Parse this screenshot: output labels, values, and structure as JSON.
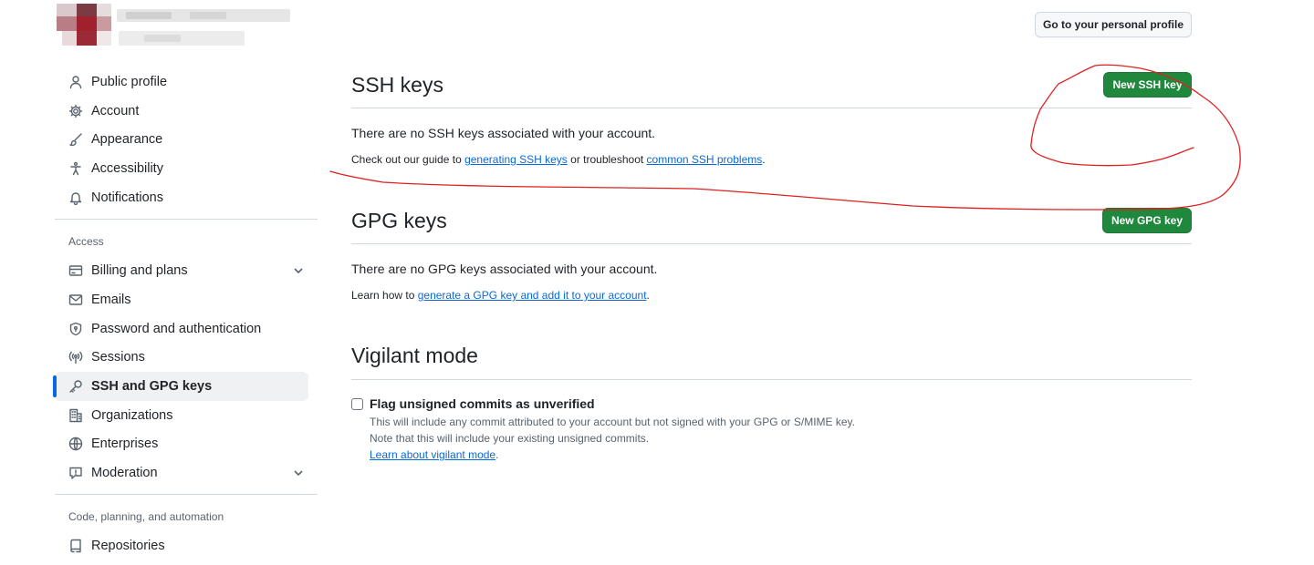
{
  "header": {
    "profile_button": "Go to your personal profile"
  },
  "sidebar": {
    "items": [
      {
        "label": "Public profile",
        "icon": "person-icon"
      },
      {
        "label": "Account",
        "icon": "gear-icon"
      },
      {
        "label": "Appearance",
        "icon": "paintbrush-icon"
      },
      {
        "label": "Accessibility",
        "icon": "accessibility-icon"
      },
      {
        "label": "Notifications",
        "icon": "bell-icon"
      }
    ],
    "access_heading": "Access",
    "access_items": [
      {
        "label": "Billing and plans",
        "icon": "credit-card-icon",
        "expandable": true
      },
      {
        "label": "Emails",
        "icon": "mail-icon"
      },
      {
        "label": "Password and authentication",
        "icon": "shield-lock-icon"
      },
      {
        "label": "Sessions",
        "icon": "broadcast-icon"
      },
      {
        "label": "SSH and GPG keys",
        "icon": "key-icon",
        "active": true
      },
      {
        "label": "Organizations",
        "icon": "organization-icon"
      },
      {
        "label": "Enterprises",
        "icon": "globe-icon"
      },
      {
        "label": "Moderation",
        "icon": "report-icon",
        "expandable": true
      }
    ],
    "code_heading": "Code, planning, and automation",
    "code_items": [
      {
        "label": "Repositories",
        "icon": "repo-icon"
      }
    ]
  },
  "ssh": {
    "title": "SSH keys",
    "button": "New SSH key",
    "empty": "There are no SSH keys associated with your account.",
    "guide_prefix": "Check out our guide to ",
    "guide_link": "generating SSH keys",
    "guide_middle": " or troubleshoot ",
    "guide_link2": "common SSH problems",
    "guide_suffix": "."
  },
  "gpg": {
    "title": "GPG keys",
    "button": "New GPG key",
    "empty": "There are no GPG keys associated with your account.",
    "learn_prefix": "Learn how to ",
    "learn_link": "generate a GPG key and add it to your account",
    "learn_suffix": "."
  },
  "vigilant": {
    "title": "Vigilant mode",
    "checkbox_label": "Flag unsigned commits as unverified",
    "checked": false,
    "note1": "This will include any commit attributed to your account but not signed with your GPG or S/MIME key.",
    "note2": "Note that this will include your existing unsigned commits.",
    "learn_link": "Learn about vigilant mode",
    "learn_suffix": "."
  },
  "colors": {
    "primary_button": "#1f883d",
    "link": "#0969da",
    "active_indicator": "#0969da",
    "annotation": "#e02020"
  }
}
